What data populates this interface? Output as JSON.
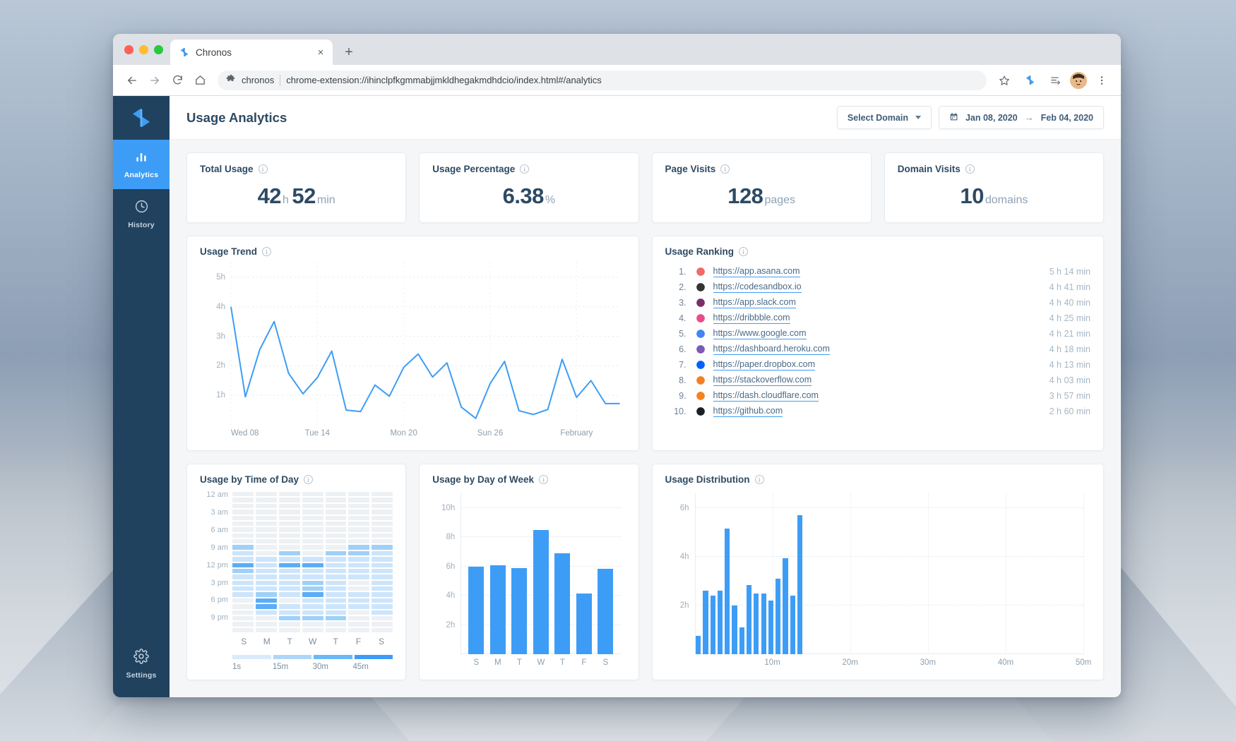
{
  "browser": {
    "tab_title": "Chronos",
    "tab_favicon": "chronos-logo-icon",
    "close_label": "×",
    "newtab_label": "+",
    "back_icon": "back-arrow-icon",
    "forward_icon": "forward-arrow-icon",
    "reload_icon": "reload-icon",
    "home_icon": "home-icon",
    "site_chip": "chronos",
    "url": "chrome-extension://ihinclpfkgmmabjjmkldhegakmdhdcio/index.html#/analytics",
    "star_icon": "bookmark-star-icon",
    "extension_icon": "chronos-extension-icon",
    "reading_list_icon": "reading-list-icon",
    "profile_icon": "profile-avatar-icon",
    "menu_icon": "three-dot-menu-icon"
  },
  "sidebar": {
    "logo": "chronos-logo-icon",
    "items": [
      {
        "label": "Analytics",
        "icon": "bar-chart-icon",
        "active": true
      },
      {
        "label": "History",
        "icon": "clock-icon",
        "active": false
      }
    ],
    "footer": {
      "label": "Settings",
      "icon": "gear-icon"
    }
  },
  "header": {
    "title": "Usage Analytics",
    "select_domain_label": "Select Domain",
    "date_start": "Jan 08, 2020",
    "date_arrow": "→",
    "date_end": "Feb 04, 2020",
    "calendar_icon": "calendar-icon"
  },
  "stats": [
    {
      "title": "Total Usage",
      "num": "42",
      "unit": "h",
      "num2": "52",
      "unit2": "min"
    },
    {
      "title": "Usage Percentage",
      "num": "6.38",
      "unit": "%",
      "num2": "",
      "unit2": ""
    },
    {
      "title": "Page Visits",
      "num": "128",
      "unit": "pages",
      "num2": "",
      "unit2": ""
    },
    {
      "title": "Domain Visits",
      "num": "10",
      "unit": "domains",
      "num2": "",
      "unit2": ""
    }
  ],
  "cards": {
    "usage_trend": "Usage Trend",
    "usage_ranking": "Usage Ranking",
    "time_of_day": "Usage by Time of Day",
    "day_of_week": "Usage by Day of Week",
    "distribution": "Usage Distribution"
  },
  "ranking": [
    {
      "rank": "1.",
      "url": "https://app.asana.com",
      "time": "5 h 14 min",
      "icon": "asana-favicon",
      "color": "#f06a6a"
    },
    {
      "rank": "2.",
      "url": "https://codesandbox.io",
      "time": "4 h 41 min",
      "icon": "codesandbox-favicon",
      "color": "#343434"
    },
    {
      "rank": "3.",
      "url": "https://app.slack.com",
      "time": "4 h 40 min",
      "icon": "slack-favicon",
      "color": "#7b2d6b"
    },
    {
      "rank": "4.",
      "url": "https://dribbble.com",
      "time": "4 h 25 min",
      "icon": "dribbble-favicon",
      "color": "#ea4c89"
    },
    {
      "rank": "5.",
      "url": "https://www.google.com",
      "time": "4 h 21 min",
      "icon": "google-favicon",
      "color": "#4285f4"
    },
    {
      "rank": "6.",
      "url": "https://dashboard.heroku.com",
      "time": "4 h 18 min",
      "icon": "heroku-favicon",
      "color": "#7b5bb5"
    },
    {
      "rank": "7.",
      "url": "https://paper.dropbox.com",
      "time": "4 h 13 min",
      "icon": "dropbox-favicon",
      "color": "#0061fe"
    },
    {
      "rank": "8.",
      "url": "https://stackoverflow.com",
      "time": "4 h 03 min",
      "icon": "stackoverflow-favicon",
      "color": "#f48024"
    },
    {
      "rank": "9.",
      "url": "https://dash.cloudflare.com",
      "time": "3 h 57 min",
      "icon": "cloudflare-favicon",
      "color": "#f6821f"
    },
    {
      "rank": "10.",
      "url": "https://github.com",
      "time": "2 h 60 min",
      "icon": "github-favicon",
      "color": "#1b1f23"
    }
  ],
  "colors": {
    "accent": "#3d9df6",
    "sidebar": "#20425f",
    "title": "#2d4a63",
    "muted": "#9fb0bf"
  },
  "chart_data": [
    {
      "id": "usage_trend",
      "type": "line",
      "title": "Usage Trend",
      "xlabel": "",
      "ylabel": "",
      "ylim": [
        0,
        5.5
      ],
      "yticks": [
        1,
        2,
        3,
        4,
        5
      ],
      "ytick_labels": [
        "1h",
        "2h",
        "3h",
        "4h",
        "5h"
      ],
      "grid": true,
      "xtick_labels": [
        "Wed 08",
        "Tue 14",
        "Mon 20",
        "Sun 26",
        "February"
      ],
      "xtick_index": [
        0,
        6,
        12,
        18,
        24
      ],
      "x": [
        "Jan 08",
        "Jan 09",
        "Jan 10",
        "Jan 11",
        "Jan 12",
        "Jan 13",
        "Jan 14",
        "Jan 15",
        "Jan 16",
        "Jan 17",
        "Jan 18",
        "Jan 19",
        "Jan 20",
        "Jan 21",
        "Jan 22",
        "Jan 23",
        "Jan 24",
        "Jan 25",
        "Jan 26",
        "Jan 27",
        "Jan 28",
        "Jan 29",
        "Jan 30",
        "Jan 31",
        "Feb 01",
        "Feb 02",
        "Feb 03",
        "Feb 04"
      ],
      "values": [
        4.0,
        0.95,
        2.55,
        3.5,
        1.75,
        1.05,
        1.6,
        2.5,
        0.5,
        0.45,
        1.35,
        0.97,
        1.95,
        2.4,
        1.62,
        2.1,
        0.6,
        0.22,
        1.4,
        2.15,
        0.48,
        0.35,
        0.52,
        2.22,
        0.93,
        1.5,
        0.72,
        0.72
      ],
      "line_color": "#3d9df6"
    },
    {
      "id": "time_of_day",
      "type": "heatmap",
      "title": "Usage by Time of Day",
      "xlabel": "",
      "ylabel": "",
      "x_categories": [
        "S",
        "M",
        "T",
        "W",
        "T",
        "F",
        "S"
      ],
      "y_tick_labels": [
        "12 am",
        "3 am",
        "6 am",
        "9 am",
        "12 pm",
        "3 pm",
        "6 pm",
        "9 pm"
      ],
      "legend_labels": [
        "1s",
        "15m",
        "30m",
        "45m"
      ],
      "legend_colors": [
        "#d9eafb",
        "#aed6fa",
        "#6bb8f7",
        "#3d9df6"
      ],
      "rows": 24,
      "cols": 7,
      "matrix": [
        [
          0,
          0,
          0,
          0,
          0,
          0,
          0
        ],
        [
          0,
          0,
          0,
          0,
          0,
          0,
          0
        ],
        [
          0,
          0,
          0,
          0,
          0,
          0,
          0
        ],
        [
          0,
          0,
          0,
          0,
          0,
          0,
          0
        ],
        [
          0,
          0,
          0,
          0,
          0,
          0,
          0
        ],
        [
          0,
          0,
          0,
          0,
          0,
          0,
          0
        ],
        [
          0,
          0,
          0,
          0,
          0,
          0,
          0
        ],
        [
          0,
          0,
          0,
          0,
          0,
          0,
          0
        ],
        [
          0,
          0,
          0,
          0,
          0,
          0,
          0
        ],
        [
          2,
          0,
          0,
          0,
          0,
          2,
          2
        ],
        [
          1,
          0,
          2,
          0,
          2,
          2,
          1
        ],
        [
          1,
          1,
          1,
          1,
          1,
          1,
          1
        ],
        [
          3,
          1,
          3,
          3,
          1,
          1,
          1
        ],
        [
          2,
          1,
          1,
          1,
          1,
          1,
          1
        ],
        [
          1,
          1,
          1,
          1,
          1,
          1,
          1
        ],
        [
          1,
          1,
          1,
          2,
          1,
          0,
          1
        ],
        [
          1,
          1,
          1,
          2,
          1,
          0,
          1
        ],
        [
          1,
          2,
          1,
          3,
          1,
          1,
          1
        ],
        [
          0,
          3,
          0,
          1,
          1,
          1,
          1
        ],
        [
          0,
          3,
          1,
          1,
          1,
          1,
          1
        ],
        [
          0,
          1,
          1,
          1,
          1,
          0,
          1
        ],
        [
          0,
          0,
          2,
          2,
          2,
          0,
          0
        ],
        [
          0,
          0,
          0,
          0,
          0,
          0,
          0
        ],
        [
          0,
          0,
          0,
          0,
          0,
          0,
          0
        ]
      ]
    },
    {
      "id": "day_of_week",
      "type": "bar",
      "title": "Usage by Day of Week",
      "categories": [
        "S",
        "M",
        "T",
        "W",
        "T",
        "F",
        "S"
      ],
      "values": [
        6.0,
        6.1,
        5.9,
        8.5,
        6.9,
        4.15,
        5.85
      ],
      "ylim": [
        0,
        11
      ],
      "yticks": [
        2,
        4,
        6,
        8,
        10
      ],
      "ytick_labels": [
        "2h",
        "4h",
        "6h",
        "8h",
        "10h"
      ],
      "xlabel": "",
      "ylabel": "",
      "bar_color": "#3d9df6",
      "grid": true
    },
    {
      "id": "distribution",
      "type": "bar",
      "title": "Usage Distribution",
      "values": [
        0.75,
        2.6,
        2.4,
        2.6,
        5.15,
        2.0,
        1.1,
        2.85,
        2.5,
        2.5,
        2.2,
        3.1,
        3.95,
        2.4,
        5.7
      ],
      "ylim": [
        0,
        6.6
      ],
      "yticks": [
        2,
        4,
        6
      ],
      "ytick_labels": [
        "2h",
        "4h",
        "6h"
      ],
      "xtick_labels": [
        "10m",
        "20m",
        "30m",
        "40m",
        "50m"
      ],
      "xtick_positions": [
        0.2,
        0.4,
        0.6,
        0.8,
        1.0
      ],
      "xlabel": "",
      "ylabel": "",
      "bar_color": "#3d9df6",
      "grid": true
    }
  ]
}
